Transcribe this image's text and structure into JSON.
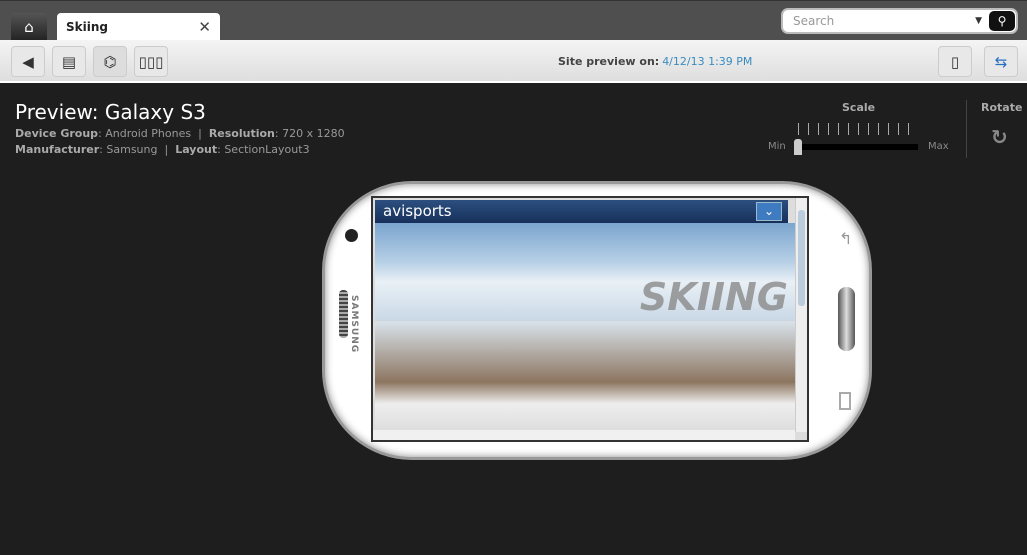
{
  "tabs": {
    "home_icon": "home-icon",
    "active": "Skiing",
    "close_icon": "close-icon"
  },
  "search": {
    "placeholder": "Search"
  },
  "toolbar": {
    "preview_label": "Site preview on:",
    "preview_time": "4/12/13 1:39 PM"
  },
  "preview": {
    "title": "Preview: Galaxy S3",
    "device_group_label": "Device Group",
    "device_group": "Android Phones",
    "resolution_label": "Resolution",
    "resolution": "720 x 1280",
    "manufacturer_label": "Manufacturer",
    "manufacturer": "Samsung",
    "layout_label": "Layout",
    "layout": "SectionLayout3"
  },
  "scale": {
    "label": "Scale",
    "min": "Min",
    "max": "Max",
    "value_fraction": 0
  },
  "rotate": {
    "label": "Rotate"
  },
  "device": {
    "brand": "SAMSUNG",
    "site_logo": "avisports",
    "banner_text": "SKIING"
  }
}
